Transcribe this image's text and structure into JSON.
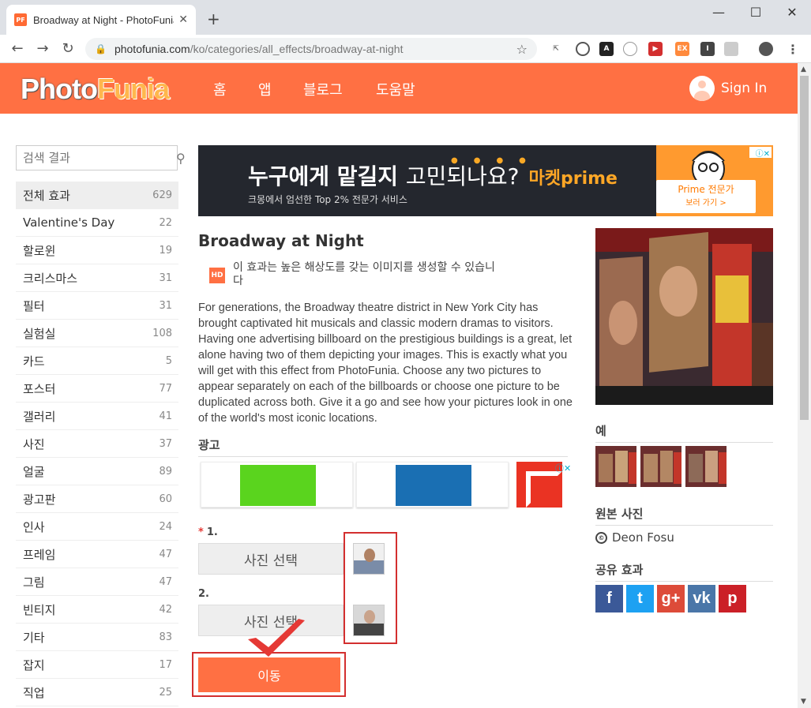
{
  "browser": {
    "tab_title": "Broadway at Night - PhotoFunia",
    "favicon_text": "PF",
    "url_host": "photofunia.com",
    "url_path": "/ko/categories/all_effects/broadway-at-night"
  },
  "site": {
    "logo_part1": "Photo",
    "logo_part2": "Funia",
    "nav": [
      "홈",
      "앱",
      "블로그",
      "도움말"
    ],
    "signin_label": "Sign In"
  },
  "sidebar": {
    "search_placeholder": "검색 결과",
    "categories": [
      {
        "label": "전체 효과",
        "count": "629"
      },
      {
        "label": "Valentine's Day",
        "count": "22"
      },
      {
        "label": "할로윈",
        "count": "19"
      },
      {
        "label": "크리스마스",
        "count": "31"
      },
      {
        "label": "필터",
        "count": "31"
      },
      {
        "label": "실험실",
        "count": "108"
      },
      {
        "label": "카드",
        "count": "5"
      },
      {
        "label": "포스터",
        "count": "77"
      },
      {
        "label": "갤러리",
        "count": "41"
      },
      {
        "label": "사진",
        "count": "37"
      },
      {
        "label": "얼굴",
        "count": "89"
      },
      {
        "label": "광고판",
        "count": "60"
      },
      {
        "label": "인사",
        "count": "24"
      },
      {
        "label": "프레임",
        "count": "47"
      },
      {
        "label": "그림",
        "count": "47"
      },
      {
        "label": "빈티지",
        "count": "42"
      },
      {
        "label": "기타",
        "count": "83"
      },
      {
        "label": "잡지",
        "count": "17"
      },
      {
        "label": "직업",
        "count": "25"
      }
    ]
  },
  "banner": {
    "headline_bold": "누구에게 맡길지",
    "headline_thin": "고민되나요?",
    "brand": "마켓prime",
    "sub": "크몽에서 엄선한 Top 2% 전문가 서비스",
    "cta_line1": "Prime 전문가",
    "cta_line2": "보러 가기 >"
  },
  "effect": {
    "title": "Broadway at Night",
    "hd_badge": "HD",
    "hd_text": "이 효과는 높은 해상도를 갖는 이미지를 생성할 수 있습니다",
    "description": "For generations, the Broadway theatre district in New York City has brought captivated hit musicals and classic modern dramas to visitors. Having one advertising billboard on the prestigious buildings is a great, let alone having two of them depicting your images. This is exactly what you will get with this effect from PhotoFunia. Choose any two pictures to appear separately on each of the billboards or choose one picture to be duplicated across both. Give it a go and see how your pictures look in one of the world's most iconic locations.",
    "ads_heading": "광고",
    "step1_num": "1.",
    "step1_required": "*",
    "step2_num": "2.",
    "choose_label": "사진 선택",
    "go_label": "이동"
  },
  "right": {
    "examples_heading": "예",
    "original_heading": "원본 사진",
    "credit_symbol": "©",
    "credit_name": "Deon Fosu",
    "share_heading": "공유 효과",
    "share_buttons": [
      {
        "icon": "f",
        "color": "#3b5998"
      },
      {
        "icon": "t",
        "color": "#1da1f2"
      },
      {
        "icon": "g+",
        "color": "#dd4b39"
      },
      {
        "icon": "vk",
        "color": "#4a76a8"
      },
      {
        "icon": "p",
        "color": "#cb2027"
      }
    ]
  }
}
